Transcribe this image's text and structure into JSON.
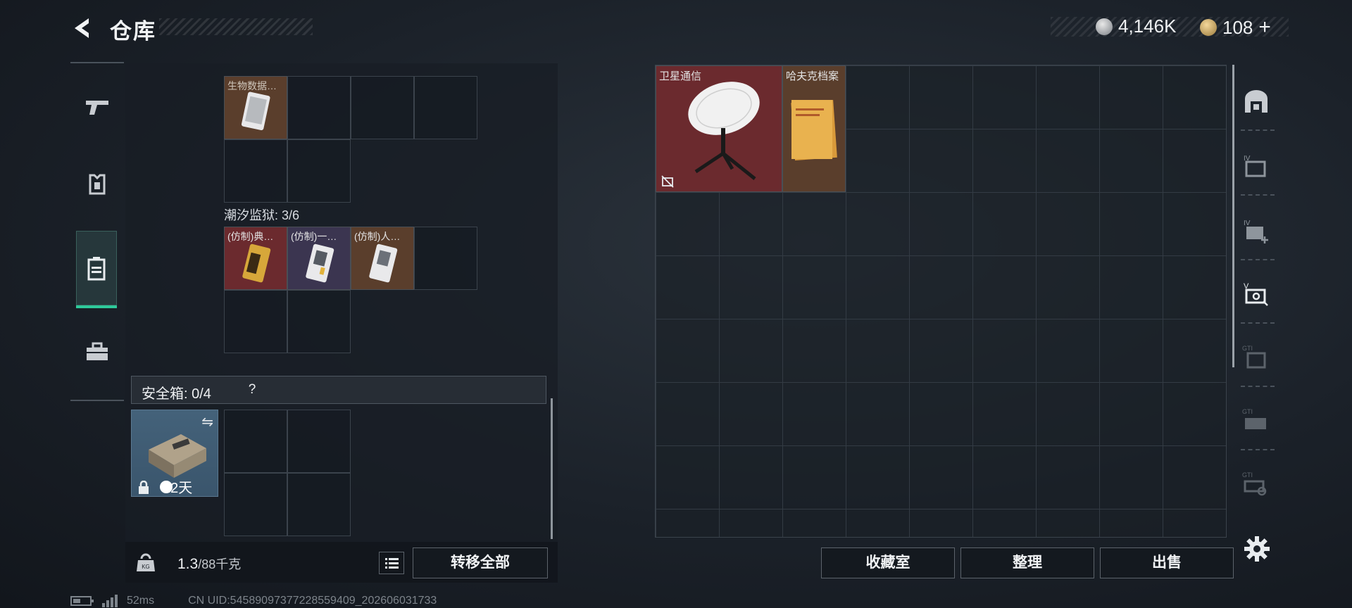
{
  "header": {
    "title": "仓库",
    "currency_silver": "4,146K",
    "currency_gold": "108",
    "currency_plus": "+"
  },
  "left_panel": {
    "group1_items": [
      {
        "label": "生物数据…"
      }
    ],
    "group2": {
      "label": "潮汐监狱: 3/6",
      "items": [
        {
          "label": "(仿制)典…"
        },
        {
          "label": "(仿制)一…"
        },
        {
          "label": "(仿制)人…"
        }
      ]
    },
    "safe": {
      "label": "安全箱: 0/4",
      "help": "?",
      "days": "22天"
    },
    "footer": {
      "weight_current": "1.3",
      "weight_max": "/88千克",
      "transfer_all": "转移全部"
    }
  },
  "storage": {
    "items": [
      {
        "label": "卫星通信"
      },
      {
        "label": "哈夫克档案"
      }
    ]
  },
  "right_footer": {
    "collection": "收藏室",
    "sort": "整理",
    "sell": "出售"
  },
  "status_bar": {
    "ping": "52ms",
    "uid": "CN UID:545890973772285594​09_202606031733"
  },
  "colors": {
    "accent": "#2ec99a",
    "item_red": "#6b2a2e",
    "item_brown": "#5a3e2c",
    "item_purple": "#3b3550"
  }
}
